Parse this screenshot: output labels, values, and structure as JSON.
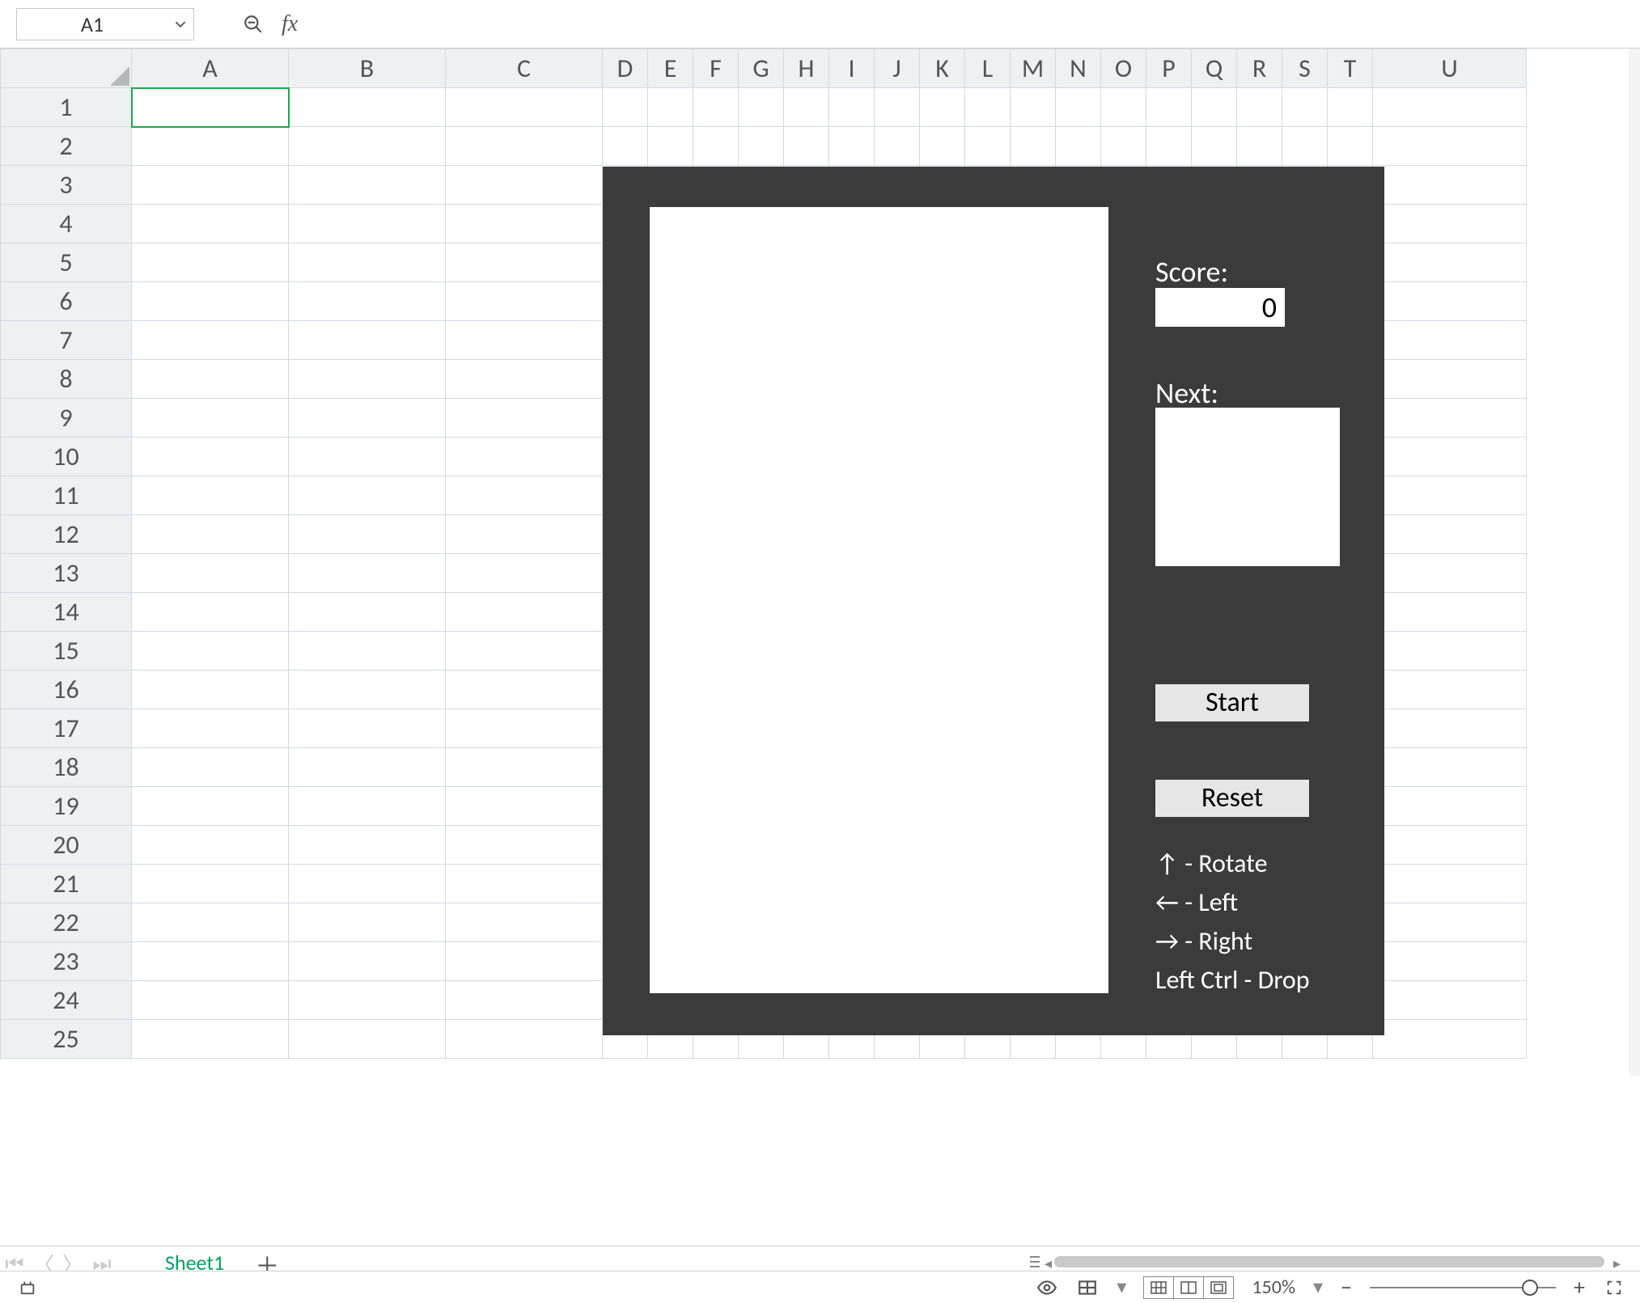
{
  "formula_bar": {
    "cell_ref": "A1",
    "fx_label": "fx",
    "formula_value": ""
  },
  "columns": [
    "A",
    "B",
    "C",
    "D",
    "E",
    "F",
    "G",
    "H",
    "I",
    "J",
    "K",
    "L",
    "M",
    "N",
    "O",
    "P",
    "Q",
    "R",
    "S",
    "T",
    "U"
  ],
  "rows": [
    "1",
    "2",
    "3",
    "4",
    "5",
    "6",
    "7",
    "8",
    "9",
    "10",
    "11",
    "12",
    "13",
    "14",
    "15",
    "16",
    "17",
    "18",
    "19",
    "20",
    "21",
    "22",
    "23",
    "24",
    "25"
  ],
  "selected": {
    "col": "A",
    "row": "1"
  },
  "tetris": {
    "score_label": "Score:",
    "score_value": "0",
    "next_label": "Next:",
    "start_label": "Start",
    "reset_label": "Reset",
    "controls": [
      "↑  -  Rotate",
      "←  -  Left",
      "→  -  Right",
      "Left Ctrl  -  Drop"
    ]
  },
  "tabs": {
    "active": "Sheet1"
  },
  "status": {
    "zoom": "150%"
  }
}
